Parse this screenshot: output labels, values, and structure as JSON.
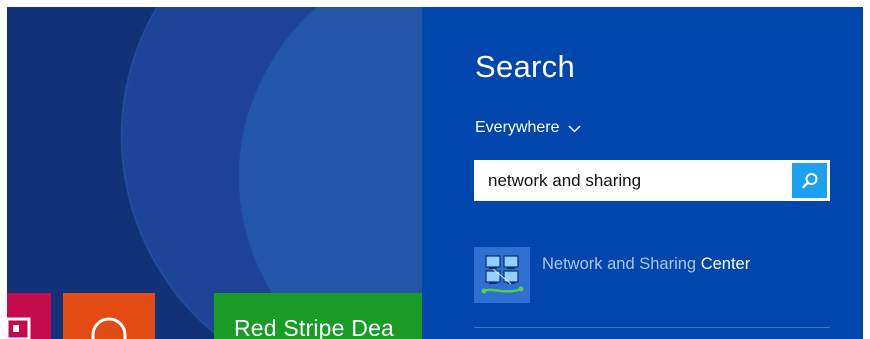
{
  "start_screen": {
    "tiles": {
      "pink": {
        "color": "#c40c4c",
        "icon": "media-icon"
      },
      "orange": {
        "color": "#e24b12",
        "icon": "headphones-icon"
      },
      "green": {
        "color": "#199c27",
        "label": "Red Stripe Dea"
      }
    }
  },
  "search_pane": {
    "title": "Search",
    "scope_label": "Everywhere",
    "query": "network and sharing",
    "search_button_icon": "search-icon",
    "results": [
      {
        "label_part_match": "Network and Sharing",
        "label_part_rest": "Center",
        "icon": "network-computers-icon"
      }
    ]
  },
  "colors": {
    "charm_background": "#0046ad",
    "start_background": "#1a3c86",
    "search_button": "#1ea0f0",
    "match_text": "#a9c6ee"
  }
}
